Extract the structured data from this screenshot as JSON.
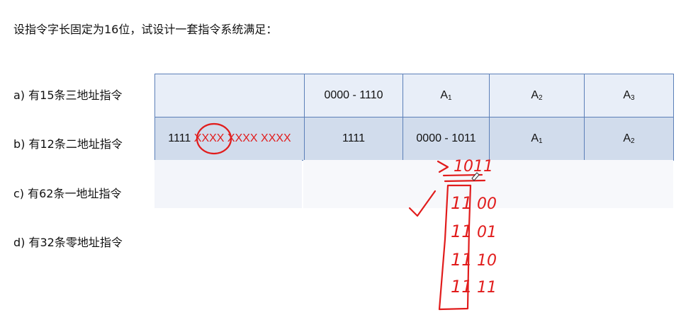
{
  "intro": "设指令字长固定为16位，试设计一套指令系统满足：",
  "requirements": [
    "a) 有15条三地址指令",
    "b) 有12条二地址指令",
    "c) 有62条一地址指令",
    "d) 有32条零地址指令"
  ],
  "table": {
    "row1": {
      "c2": "0000 - 1110",
      "a1": "A",
      "a1_sub": "1",
      "a2": "A",
      "a2_sub": "2",
      "a3": "A",
      "a3_sub": "3"
    },
    "row2": {
      "c1_prefix": "1111 ",
      "c1_circled": "XXXX",
      "c1_rest": " XXXX XXXX",
      "c2": "1111",
      "c3": "0000 - 1011",
      "a1": "A",
      "a1_sub": "1",
      "a2": "A",
      "a2_sub": "2"
    }
  },
  "handwriting": {
    "top_value": "1011",
    "column_left": [
      "11",
      "11",
      "11",
      "11"
    ],
    "column_right": [
      "00",
      "01",
      "10",
      "11"
    ]
  },
  "colors": {
    "ink": "#e11c1c",
    "table_border": "#5b7fb8",
    "row1_fill": "#e8eef8",
    "row2_fill": "#d1dcec"
  }
}
